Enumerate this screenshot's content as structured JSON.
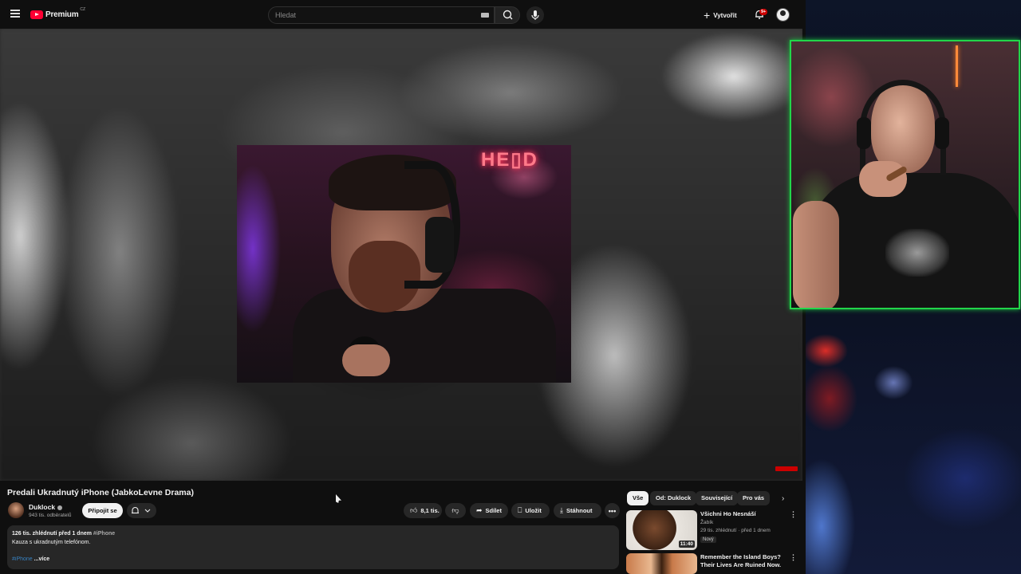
{
  "header": {
    "logo_text": "Premium",
    "logo_country": "CZ",
    "search_placeholder": "Hledat",
    "create_label": "Vytvořit",
    "notif_badge": "9+"
  },
  "video": {
    "title": "Predali Ukradnutý iPhone (JabkoLevne Drama)",
    "neon_sign": "HE▯D"
  },
  "channel": {
    "name": "Duklock",
    "subscribers": "943 tis. odběratelů",
    "join_label": "Připojit se"
  },
  "actions": {
    "likes": "8,1 tis.",
    "share": "Sdílet",
    "save": "Uložit",
    "download": "Stáhnout"
  },
  "description": {
    "meta": "126 tis. zhlédnutí  před 1 dnem",
    "meta_tag": "#iPhone",
    "line1": "Kauza s ukradnutým telefónom.",
    "hashtag": "#iPhone",
    "more": "...více"
  },
  "chips": [
    "Vše",
    "Od: Duklock",
    "Související",
    "Pro vás"
  ],
  "recommendations": [
    {
      "title": "Všichni Ho Nesnáší",
      "channel": "Žabík",
      "meta": "29 tis. zhlédnutí · před 1 dnem",
      "badge": "Nový",
      "duration": "11:40"
    },
    {
      "title": "Remember the Island Boys? Their Lives Are Ruined Now.",
      "channel": "",
      "meta": "",
      "badge": "",
      "duration": ""
    }
  ],
  "colors": {
    "youtube_red": "#ff0033",
    "webcam_border": "#22d64a",
    "background": "#0f0f0f"
  }
}
